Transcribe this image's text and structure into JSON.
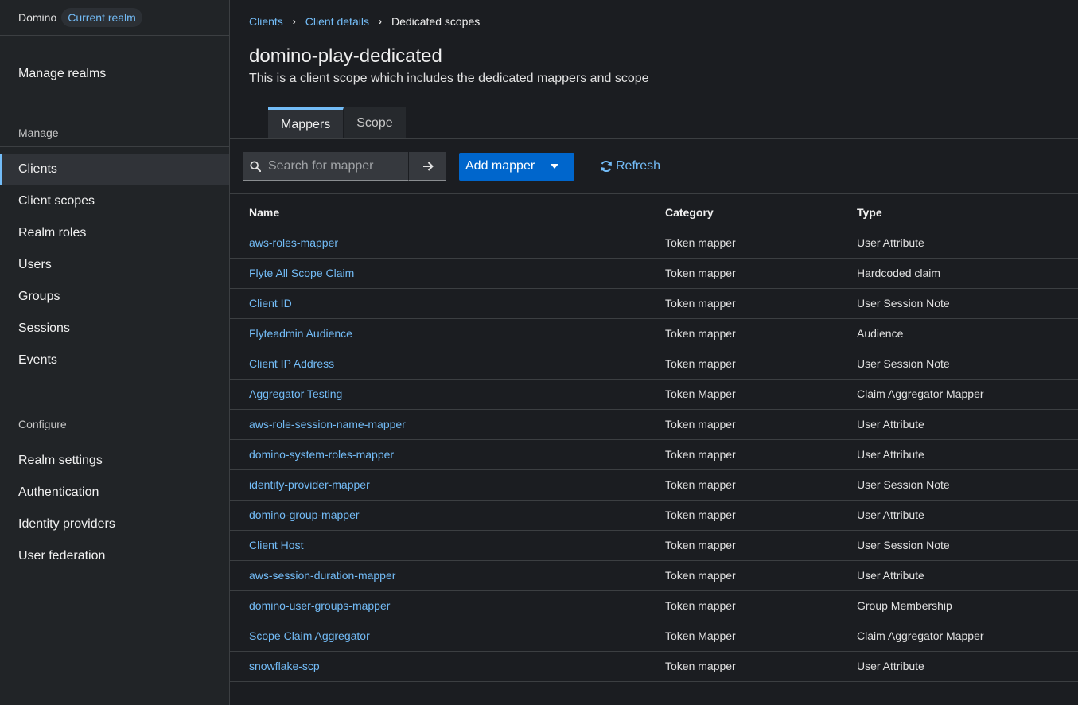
{
  "realm": {
    "name": "Domino",
    "badge": "Current realm"
  },
  "sidebar": {
    "top_item": "Manage realms",
    "manage_title": "Manage",
    "manage_items": [
      "Clients",
      "Client scopes",
      "Realm roles",
      "Users",
      "Groups",
      "Sessions",
      "Events"
    ],
    "configure_title": "Configure",
    "configure_items": [
      "Realm settings",
      "Authentication",
      "Identity providers",
      "User federation"
    ],
    "active": "Clients"
  },
  "breadcrumb": {
    "first": "Clients",
    "second": "Client details",
    "current": "Dedicated scopes"
  },
  "page": {
    "title": "domino-play-dedicated",
    "description": "This is a client scope which includes the dedicated mappers and scope"
  },
  "tabs": [
    {
      "label": "Mappers",
      "active": true
    },
    {
      "label": "Scope",
      "active": false
    }
  ],
  "toolbar": {
    "search_placeholder": "Search for mapper",
    "add_label": "Add mapper",
    "refresh_label": "Refresh"
  },
  "colors": {
    "accent": "#73bcf7",
    "primary_button": "#0066cc",
    "background": "#1b1d21",
    "sidebar": "#212427"
  },
  "table": {
    "headers": {
      "name": "Name",
      "category": "Category",
      "type": "Type"
    },
    "rows": [
      {
        "name": "aws-roles-mapper",
        "category": "Token mapper",
        "type": "User Attribute"
      },
      {
        "name": "Flyte All Scope Claim",
        "category": "Token mapper",
        "type": "Hardcoded claim"
      },
      {
        "name": "Client ID",
        "category": "Token mapper",
        "type": "User Session Note"
      },
      {
        "name": "Flyteadmin Audience",
        "category": "Token mapper",
        "type": "Audience"
      },
      {
        "name": "Client IP Address",
        "category": "Token mapper",
        "type": "User Session Note"
      },
      {
        "name": "Aggregator Testing",
        "category": "Token Mapper",
        "type": "Claim Aggregator Mapper"
      },
      {
        "name": "aws-role-session-name-mapper",
        "category": "Token mapper",
        "type": "User Attribute"
      },
      {
        "name": "domino-system-roles-mapper",
        "category": "Token mapper",
        "type": "User Attribute"
      },
      {
        "name": "identity-provider-mapper",
        "category": "Token mapper",
        "type": "User Session Note"
      },
      {
        "name": "domino-group-mapper",
        "category": "Token mapper",
        "type": "User Attribute"
      },
      {
        "name": "Client Host",
        "category": "Token mapper",
        "type": "User Session Note"
      },
      {
        "name": "aws-session-duration-mapper",
        "category": "Token mapper",
        "type": "User Attribute"
      },
      {
        "name": "domino-user-groups-mapper",
        "category": "Token mapper",
        "type": "Group Membership"
      },
      {
        "name": "Scope Claim Aggregator",
        "category": "Token Mapper",
        "type": "Claim Aggregator Mapper"
      },
      {
        "name": "snowflake-scp",
        "category": "Token mapper",
        "type": "User Attribute"
      }
    ]
  }
}
